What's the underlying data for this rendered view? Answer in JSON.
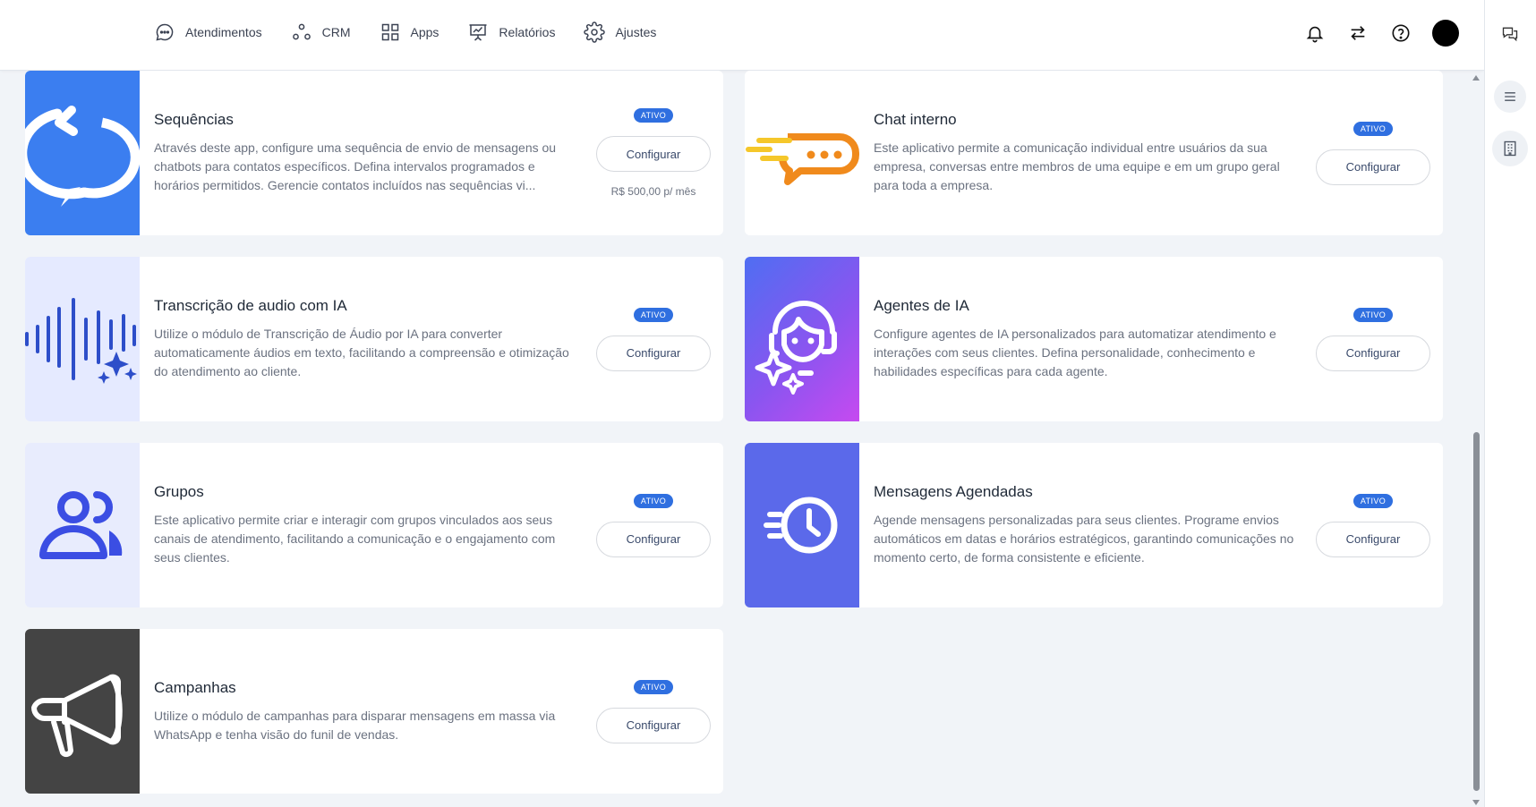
{
  "nav": {
    "items": [
      {
        "label": "Atendimentos",
        "icon": "chat-bubble-icon"
      },
      {
        "label": "CRM",
        "icon": "crm-nodes-icon"
      },
      {
        "label": "Apps",
        "icon": "apps-grid-icon"
      },
      {
        "label": "Relatórios",
        "icon": "presentation-chart-icon"
      },
      {
        "label": "Ajustes",
        "icon": "gear-icon"
      }
    ]
  },
  "top_actions": [
    "bell-icon",
    "swap-arrows-icon",
    "help-circle-icon",
    "avatar"
  ],
  "rail": [
    "chats-icon",
    "menu-lines-icon",
    "building-icon"
  ],
  "colors": {
    "badge": "#2f6fe0",
    "background": "#f1f4f8",
    "seq_img": "#3b7ef0",
    "transcription_img": "#e5eaff",
    "groups_img": "#e8ecfd",
    "agents_img_start": "#4f6ef2",
    "agents_img_end": "#c64af0",
    "scheduled_img": "#5b69ea",
    "campaigns_img": "#444444"
  },
  "cards": [
    {
      "title": "Sequências",
      "description": "Através deste app, configure uma sequência de envio de mensagens ou chatbots para contatos específicos. Defina intervalos programados e horários permitidos. Gerencie contatos incluídos nas sequências vi...",
      "badge": "ATIVO",
      "button": "Configurar",
      "price": "R$ 500,00 p/ mês",
      "icon": "repeat-arrow-icon"
    },
    {
      "title": "Chat interno",
      "description": "Este aplicativo permite a comunicação individual entre usuários da sua empresa, conversas entre membros de uma equipe e em um grupo geral para toda a empresa.",
      "badge": "ATIVO",
      "button": "Configurar",
      "icon": "fast-chat-icon"
    },
    {
      "title": "Transcrição de audio com IA",
      "description": "Utilize o módulo de Transcrição de Áudio por IA para converter automaticamente áudios em texto, facilitando a compreensão e otimização do atendimento ao cliente.",
      "badge": "ATIVO",
      "button": "Configurar",
      "icon": "audio-wave-icon"
    },
    {
      "title": "Agentes de IA",
      "description": "Configure agentes de IA personalizados para automatizar atendimento e interações com seus clientes. Defina personalidade, conhecimento e habilidades específicas para cada agente.",
      "badge": "ATIVO",
      "button": "Configurar",
      "icon": "ai-agent-icon"
    },
    {
      "title": "Grupos",
      "description": "Este aplicativo permite criar e interagir com grupos vinculados aos seus canais de atendimento, facilitando a comunicação e o engajamento com seus clientes.",
      "badge": "ATIVO",
      "button": "Configurar",
      "icon": "users-group-icon"
    },
    {
      "title": "Mensagens Agendadas",
      "description": "Agende mensagens personalizadas para seus clientes. Programe envios automáticos em datas e horários estratégicos, garantindo comunicações no momento certo, de forma consistente e eficiente.",
      "badge": "ATIVO",
      "button": "Configurar",
      "icon": "scheduled-clock-icon"
    },
    {
      "title": "Campanhas",
      "description": "Utilize o módulo de campanhas para disparar mensagens em massa via WhatsApp e tenha visão do funil de vendas.",
      "badge": "ATIVO",
      "button": "Configurar",
      "icon": "megaphone-icon"
    }
  ]
}
